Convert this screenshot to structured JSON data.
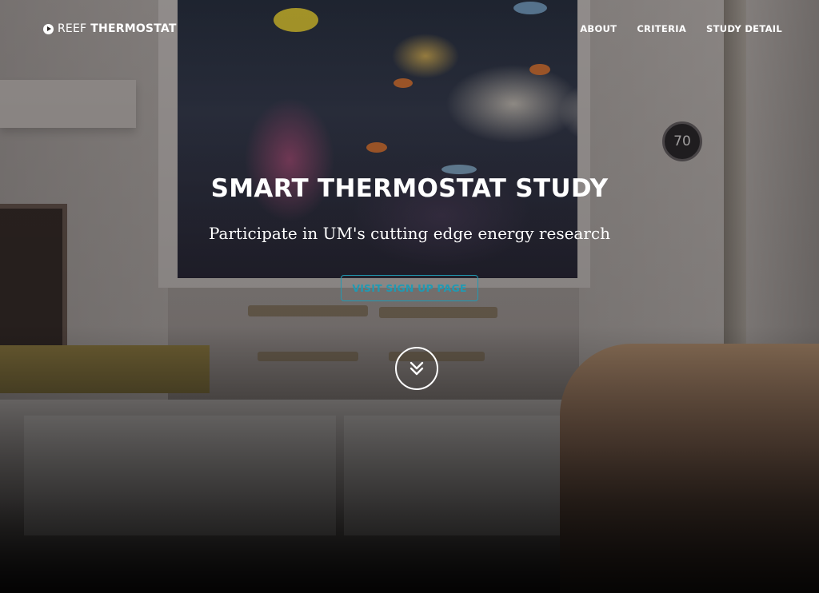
{
  "brand": {
    "icon": "play-circle-icon",
    "light_text": "REEF",
    "bold_text": "THERMOSTAT"
  },
  "nav": {
    "items": [
      {
        "label": "ABOUT"
      },
      {
        "label": "CRITERIA"
      },
      {
        "label": "STUDY DETAIL"
      }
    ]
  },
  "intro": {
    "title": "SMART THERMOSTAT STUDY",
    "subtitle": "Participate in UM's cutting edge energy research",
    "signup_label": "VISIT SIGN UP PAGE",
    "scroll_icon": "double-chevron-down-icon"
  },
  "background": {
    "thermostat_reading": "70"
  },
  "colors": {
    "accent": "#219ab3",
    "text": "#ffffff"
  }
}
